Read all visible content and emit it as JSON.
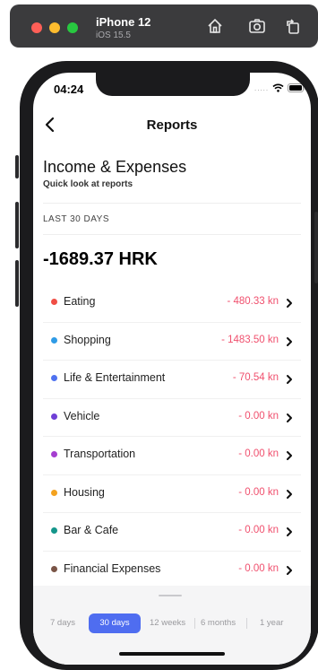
{
  "simulator": {
    "device_name": "iPhone 12",
    "os_version": "iOS 15.5",
    "buttons": [
      "home-icon",
      "screenshot-icon",
      "rotate-icon"
    ]
  },
  "status_bar": {
    "time": "04:24",
    "dots": "....."
  },
  "nav": {
    "title": "Reports"
  },
  "header": {
    "title": "Income & Expenses",
    "subtitle": "Quick look at reports"
  },
  "period_label": "LAST 30 DAYS",
  "total": "-1689.37 HRK",
  "categories": [
    {
      "name": "Eating",
      "amount": "- 480.33 kn",
      "color": "#f04e45"
    },
    {
      "name": "Shopping",
      "amount": "- 1483.50 kn",
      "color": "#2f9be6"
    },
    {
      "name": "Life & Entertainment",
      "amount": "- 70.54 kn",
      "color": "#4f72f0"
    },
    {
      "name": "Vehicle",
      "amount": "- 0.00 kn",
      "color": "#6f3fd6"
    },
    {
      "name": "Transportation",
      "amount": "- 0.00 kn",
      "color": "#a53ed0"
    },
    {
      "name": "Housing",
      "amount": "- 0.00 kn",
      "color": "#f3a21f"
    },
    {
      "name": "Bar & Cafe",
      "amount": "- 0.00 kn",
      "color": "#14968b"
    },
    {
      "name": "Financial Expenses",
      "amount": "- 0.00 kn",
      "color": "#7a5547"
    }
  ],
  "period_tabs": {
    "options": [
      "7 days",
      "30 days",
      "12 weeks",
      "6 months",
      "1 year"
    ],
    "selected": "30 days"
  }
}
